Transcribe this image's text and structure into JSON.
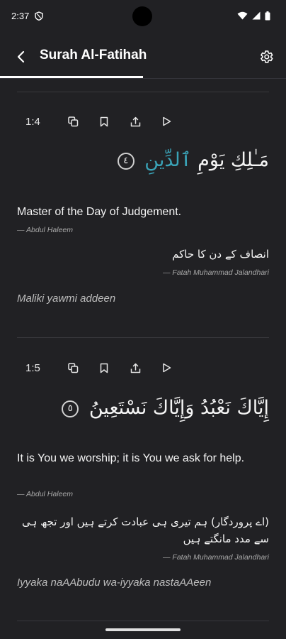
{
  "status_bar": {
    "time": "2:37"
  },
  "app_bar": {
    "title": "Surah Al-Fatihah"
  },
  "verses": [
    {
      "number": "1:4",
      "arabic_main": "مَـٰلِكِ يَوْمِ ",
      "arabic_highlight": "ٱلدِّينِ",
      "ayah_marker": "٤",
      "translation": "Master of the Day of Judgement.",
      "translator": "— Abdul Haleem",
      "urdu": "انصاف کے دن کا حاکم",
      "urdu_translator": "— Fatah Muhammad Jalandhari",
      "transliteration": "Maliki yawmi addeen"
    },
    {
      "number": "1:5",
      "arabic_main": "إِيَّاكَ نَعْبُدُ وَإِيَّاكَ نَسْتَعِينُ",
      "ayah_marker": "٥",
      "translation": "It is You we worship; it is You we ask for help.",
      "translator": "— Abdul Haleem",
      "urdu": "(اے پروردگار) ہم تیری ہی عبادت کرتے ہیں اور تجھ ہی سے مدد مانگتے ہیں",
      "urdu_translator": "— Fatah Muhammad Jalandhari",
      "transliteration": "Iyyaka naAAbudu wa-iyyaka nastaAAeen"
    }
  ]
}
